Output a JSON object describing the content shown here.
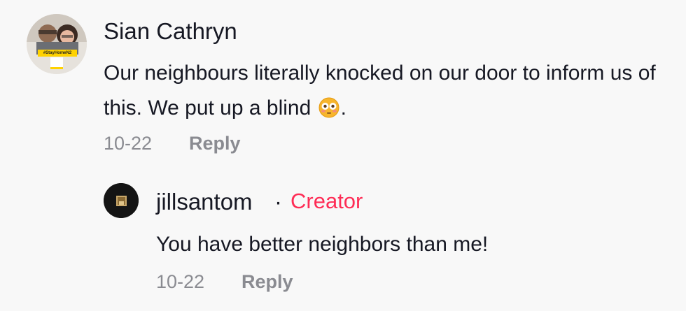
{
  "main_comment": {
    "username": "Sian Cathryn",
    "avatar_badge_text": "#StayHomeN2",
    "text_before_emoji": "Our neighbours literally knocked on our door to inform us of this. We put up a blind",
    "emoji": "flushed-face",
    "text_after_emoji": ".",
    "date": "10-22",
    "reply_label": "Reply"
  },
  "reply_comment": {
    "username": "jillsantom",
    "separator": "·",
    "badge": "Creator",
    "text": "You have better neighbors than me!",
    "date": "10-22",
    "reply_label": "Reply"
  },
  "colors": {
    "background": "#f8f8f8",
    "text": "#161823",
    "meta": "#8a8b91",
    "creator": "#fe2c55"
  }
}
